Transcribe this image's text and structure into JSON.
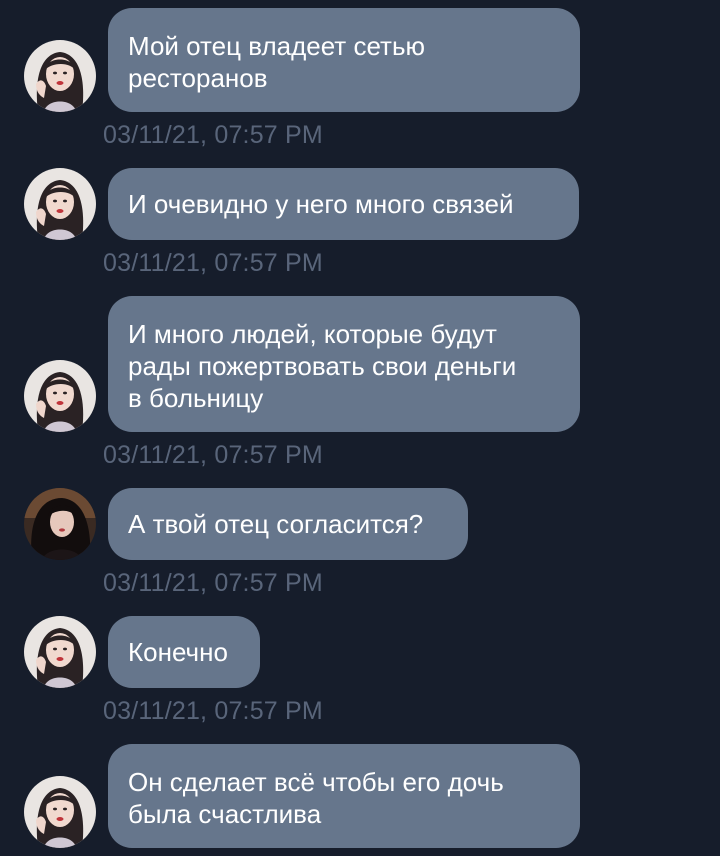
{
  "colors": {
    "background": "#161d2b",
    "bubble": "#66768c",
    "bubble_text": "#ffffff",
    "timestamp": "#59657a"
  },
  "messages": [
    {
      "sender": "self",
      "avatar_icon": "user-avatar-icon",
      "text": "Мой отец владеет сетью\nресторанов",
      "timestamp": "03/11/21, 07:57 PM"
    },
    {
      "sender": "self",
      "avatar_icon": "user-avatar-icon",
      "text": "И очевидно у него много связей",
      "timestamp": "03/11/21, 07:57 PM"
    },
    {
      "sender": "self",
      "avatar_icon": "user-avatar-icon",
      "text": "И много людей, которые будут\nрады пожертвовать свои деньги\nв больницу",
      "timestamp": "03/11/21, 07:57 PM"
    },
    {
      "sender": "other",
      "avatar_icon": "contact-avatar-icon",
      "text": "А твой отец согласится?",
      "timestamp": "03/11/21, 07:57 PM"
    },
    {
      "sender": "self",
      "avatar_icon": "user-avatar-icon",
      "text": "Конечно",
      "timestamp": "03/11/21, 07:57 PM"
    },
    {
      "sender": "self",
      "avatar_icon": "user-avatar-icon",
      "text": "Он сделает всё чтобы его дочь\nбыла счастлива",
      "timestamp": ""
    }
  ]
}
